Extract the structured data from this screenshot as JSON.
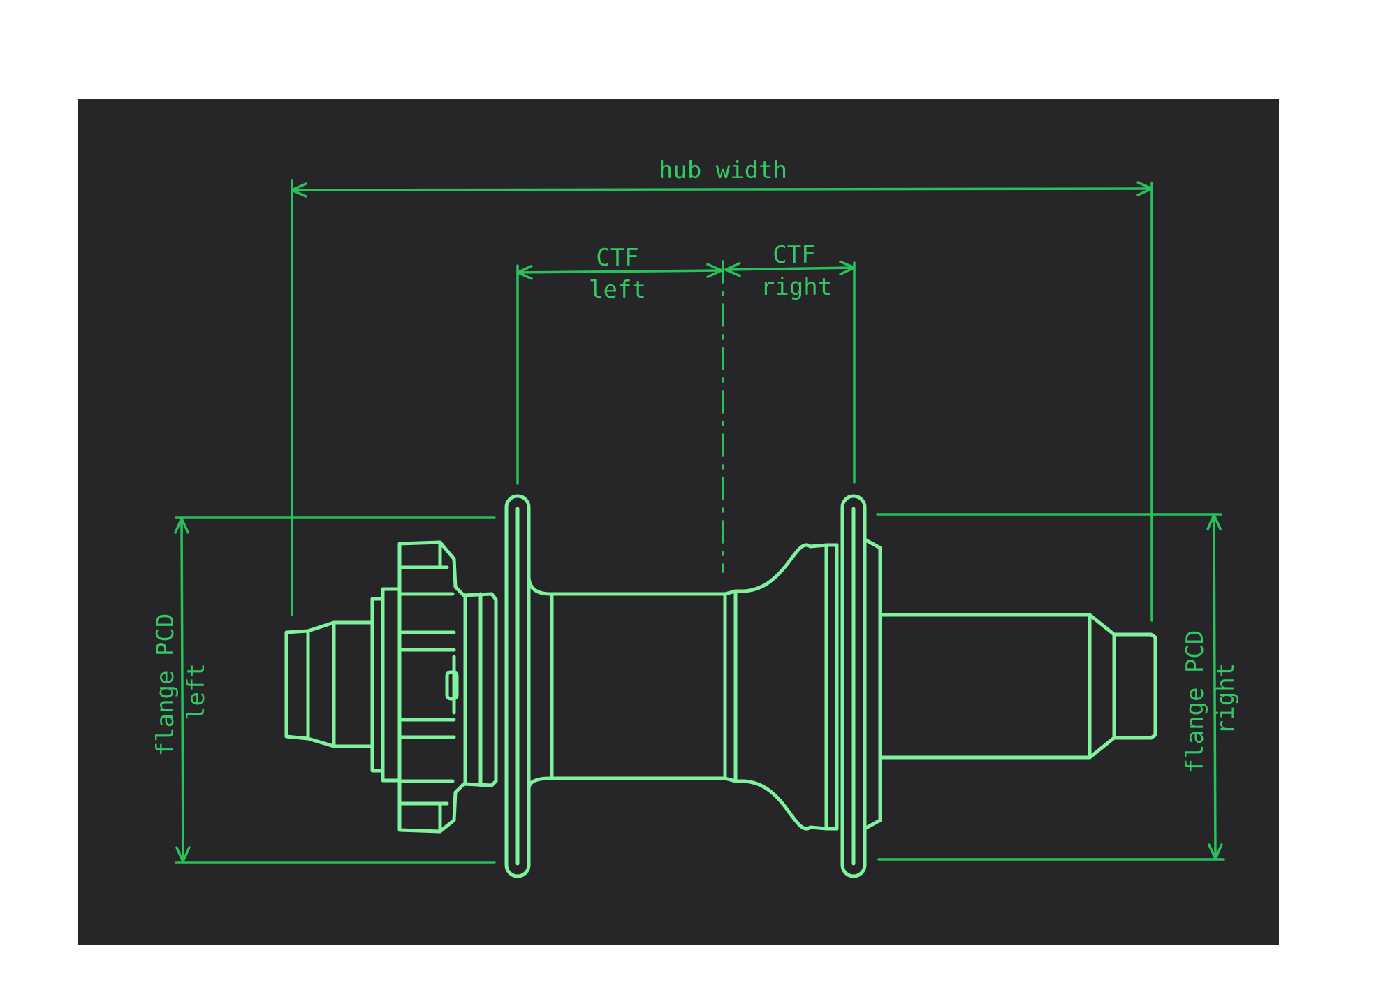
{
  "colors": {
    "page_background": "#ffffff",
    "panel_background": "#262628",
    "outline": "#7ef29d",
    "dimension": "#27c25a",
    "label": "#34c864"
  },
  "labels": {
    "hub_width": "hub width",
    "ctf_left_line1": "CTF",
    "ctf_left_line2": "left",
    "ctf_right_line1": "CTF",
    "ctf_right_line2": "right",
    "pcd_left_line1": "flange PCD",
    "pcd_left_line2": "left",
    "pcd_right_line1": "flange PCD",
    "pcd_right_line2": "right"
  }
}
